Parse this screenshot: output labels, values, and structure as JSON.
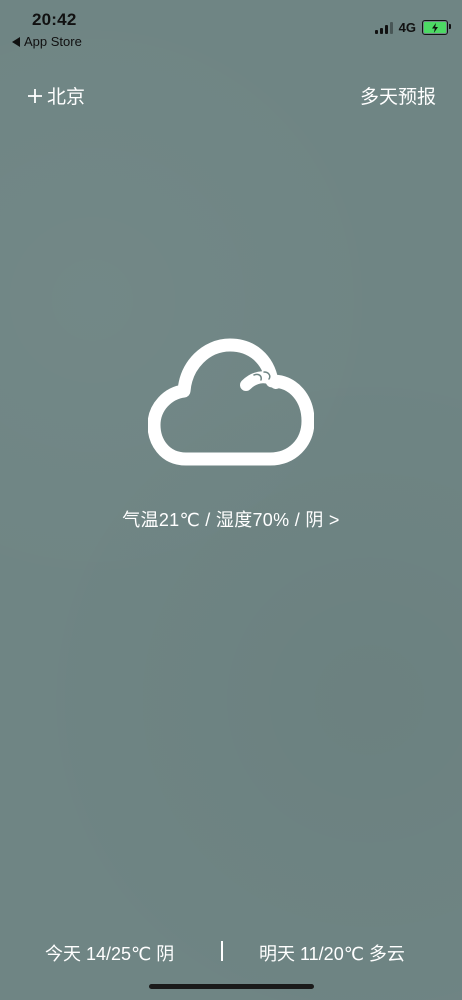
{
  "status_bar": {
    "time": "20:42",
    "back_app": "App Store",
    "network": "4G"
  },
  "nav": {
    "city": "北京",
    "forecast_label": "多天预报"
  },
  "current": {
    "condition_icon": "cloud-icon",
    "summary": "气温21℃ / 湿度70% / 阴 >"
  },
  "forecast": {
    "today": "今天 14/25℃ 阴",
    "tomorrow": "明天 11/20℃ 多云"
  },
  "colors": {
    "background": "#6f8584",
    "foreground": "#ffffff",
    "battery": "#4cd964"
  }
}
